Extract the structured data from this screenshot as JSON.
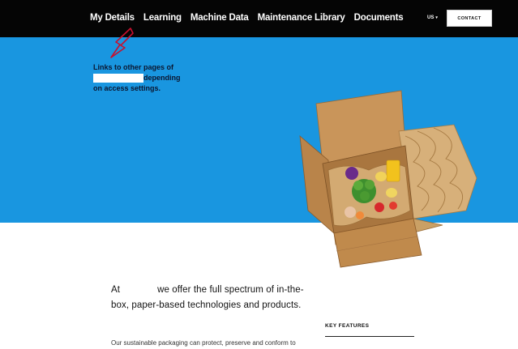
{
  "nav": {
    "links": [
      "My Details",
      "Learning",
      "Machine Data",
      "Maintenance Library",
      "Documents"
    ],
    "language": "US",
    "contact_label": "CONTACT"
  },
  "annotation": {
    "line1": "Links to other pages of",
    "line2_after": "depending",
    "line3": "on access settings."
  },
  "intro": {
    "prefix": "At",
    "rest": "we offer the full spectrum of in-the-box, paper-based technologies and products."
  },
  "body_text": "Our sustainable packaging can protect, preserve and conform to",
  "key_features": {
    "heading": "KEY FEATURES"
  },
  "colors": {
    "nav_bg": "#050505",
    "hero_bg": "#1996e0",
    "annotation_arrow": "#c8102e"
  }
}
